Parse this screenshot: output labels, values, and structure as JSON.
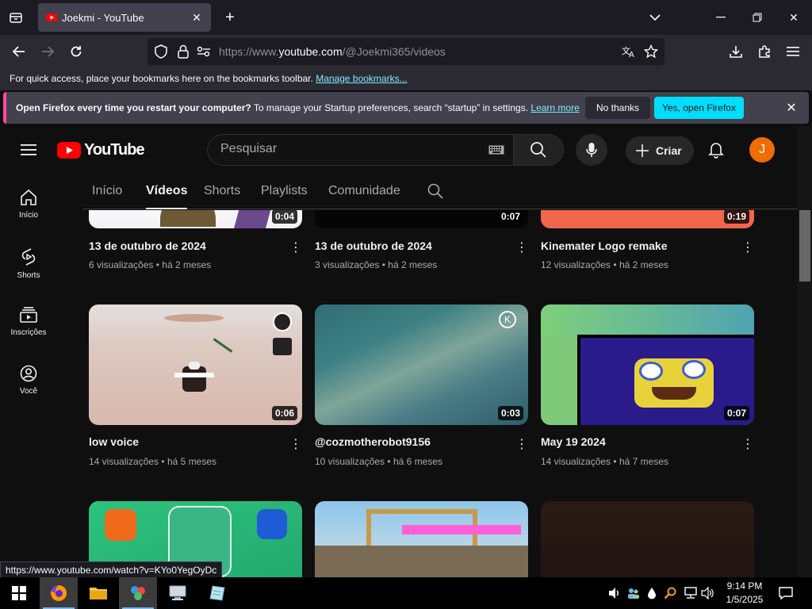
{
  "browser": {
    "tab_title": "Joekmi - YouTube",
    "url_prefix": "https://www.",
    "url_domain": "youtube.com",
    "url_path": "/@Joekmi365/videos",
    "bookmarks_text": "For quick access, place your bookmarks here on the bookmarks toolbar.",
    "bookmarks_link": "Manage bookmarks...",
    "notification": {
      "bold": "Open Firefox every time you restart your computer?",
      "text": "To manage your Startup preferences, search “startup” in settings.",
      "link": "Learn more",
      "no_thanks": "No thanks",
      "yes": "Yes, open Firefox"
    },
    "status_url": "https://www.youtube.com/watch?v=KYo0YegOyDc"
  },
  "youtube": {
    "logo_text": "YouTube",
    "search_placeholder": "Pesquisar",
    "create_label": "Criar",
    "avatar_letter": "J",
    "sidebar": [
      {
        "label": "Início",
        "icon": "home-icon"
      },
      {
        "label": "Shorts",
        "icon": "shorts-icon"
      },
      {
        "label": "Inscrições",
        "icon": "subscriptions-icon"
      },
      {
        "label": "Você",
        "icon": "you-icon"
      }
    ],
    "tabs": [
      "Início",
      "Vídeos",
      "Shorts",
      "Playlists",
      "Comunidade"
    ],
    "active_tab": "Vídeos",
    "videos": [
      {
        "title": "13 de outubro de 2024",
        "views": "6 visualizações",
        "age": "há 2 meses",
        "duration": "0:04"
      },
      {
        "title": "13 de outubro de 2024",
        "views": "3 visualizações",
        "age": "há 2 meses",
        "duration": "0:07"
      },
      {
        "title": "Kinemater Logo remake",
        "views": "12 visualizações",
        "age": "há 2 meses",
        "duration": "0:19"
      },
      {
        "title": "low voice",
        "views": "14 visualizações",
        "age": "há 5 meses",
        "duration": "0:06"
      },
      {
        "title": "@cozmotherobot9156",
        "views": "10 visualizações",
        "age": "há 6 meses",
        "duration": "0:03"
      },
      {
        "title": "May 19 2024",
        "views": "14 visualizações",
        "age": "há 7 meses",
        "duration": "0:07"
      }
    ],
    "meta_sep": "•"
  },
  "taskbar": {
    "time": "9:14 PM",
    "date": "1/5/2025"
  }
}
